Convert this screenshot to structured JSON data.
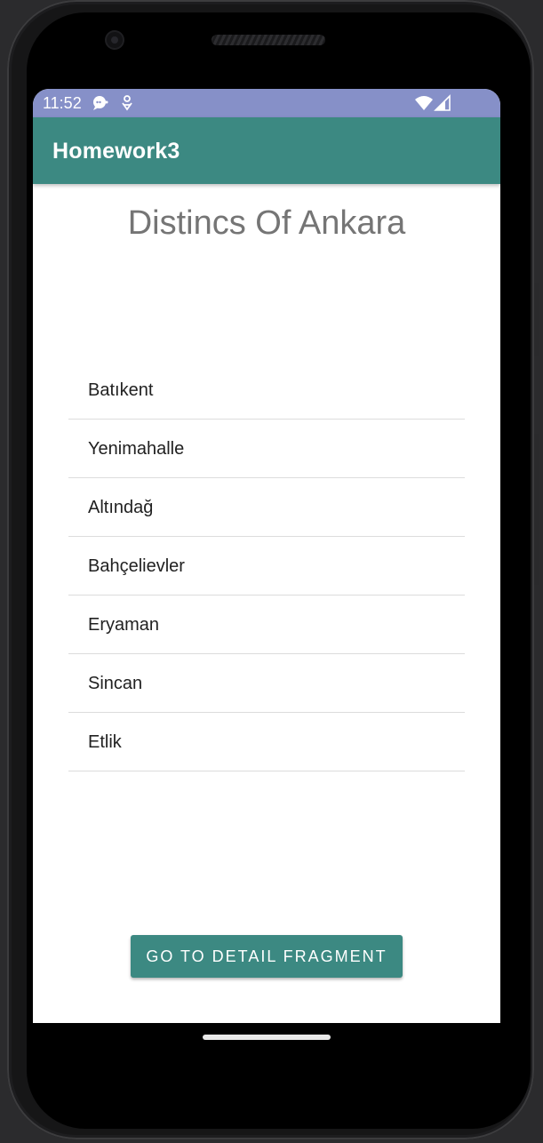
{
  "status_bar": {
    "time": "11:52",
    "icons": [
      "chat-bubble-icon",
      "usb-debug-icon",
      "wifi-icon",
      "signal-icon"
    ],
    "color": "#8690c8"
  },
  "app_bar": {
    "title": "Homework3",
    "color": "#3c8982"
  },
  "main": {
    "title": "Distincs Of Ankara",
    "districts": [
      "Batıkent",
      "Yenimahalle",
      "Altındağ",
      "Bahçelievler",
      "Eryaman",
      "Sincan",
      "Etlik"
    ],
    "button_label": "GO TO DETAIL FRAGMENT"
  }
}
